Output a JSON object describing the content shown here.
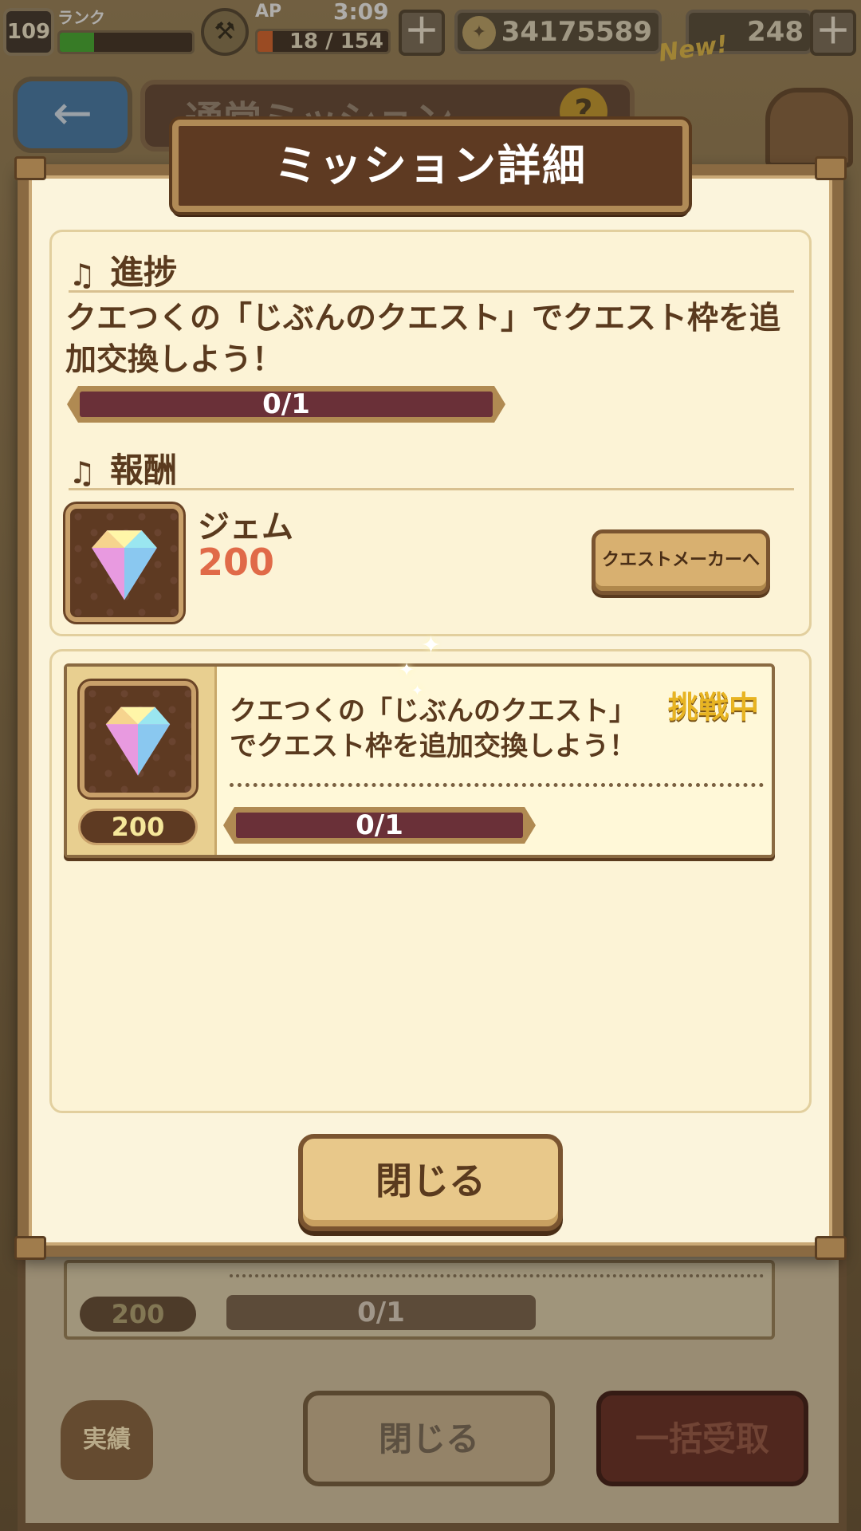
{
  "status_bar": {
    "rank_value": "109",
    "rank_label": "ランク",
    "rank_progress": 0.26,
    "ap_label": "AP",
    "ap_value": "18 / 154",
    "ap_progress": 0.117,
    "clock": "3:09",
    "coins": "34175589",
    "gems": "248",
    "new_label": "New!",
    "plus_icon": "＋"
  },
  "background_screen": {
    "title": "通常ミッション",
    "help_icon": "?",
    "back_icon": "←",
    "row_badge": "200",
    "row_progress": "0/1",
    "achievements_label": "実績",
    "close_label": "閉じる",
    "claim_all_label": "一括受取"
  },
  "modal": {
    "title": "ミッション詳細",
    "progress_section": {
      "heading": "進捗",
      "description": "クエつくの「じぶんのクエスト」でクエスト枠を追加交換しよう！",
      "progress_text": "0/1",
      "progress_fraction": 0
    },
    "reward_section": {
      "heading": "報酬",
      "item_name": "ジェム",
      "item_amount": "200",
      "item_icon": "gem-icon",
      "goto_button_label": "クエストメーカーへ"
    },
    "mission_card": {
      "status": "挑戦中",
      "text_line1": "クエつくの「じぶんのクエスト」",
      "text_line2": "でクエスト枠を追加交換しよう！",
      "reward_amount": "200",
      "progress_text": "0/1",
      "progress_fraction": 0
    },
    "close_button_label": "閉じる"
  },
  "colors": {
    "panel_bg": "#fbf4dc",
    "frame": "#8a6a42",
    "title_bg": "#5e3a22",
    "text": "#5a3a1e",
    "reward_value": "#e06a48",
    "status": "#e8b422"
  }
}
